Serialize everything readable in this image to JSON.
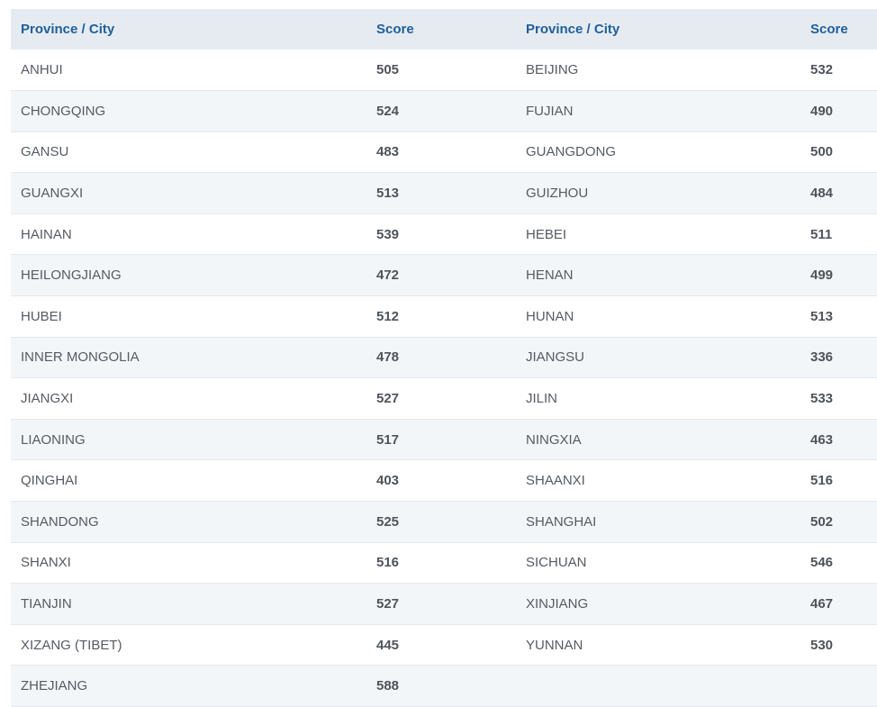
{
  "headers": {
    "province_left": "Province / City",
    "score_left": "Score",
    "province_right": "Province / City",
    "score_right": "Score"
  },
  "rows": [
    {
      "left_name": "ANHUI",
      "left_score": "505",
      "right_name": "BEIJING",
      "right_score": "532"
    },
    {
      "left_name": "CHONGQING",
      "left_score": "524",
      "right_name": "FUJIAN",
      "right_score": "490"
    },
    {
      "left_name": "GANSU",
      "left_score": "483",
      "right_name": "GUANGDONG",
      "right_score": "500"
    },
    {
      "left_name": "GUANGXI",
      "left_score": "513",
      "right_name": "GUIZHOU",
      "right_score": "484"
    },
    {
      "left_name": "HAINAN",
      "left_score": "539",
      "right_name": "HEBEI",
      "right_score": "511"
    },
    {
      "left_name": "HEILONGJIANG",
      "left_score": "472",
      "right_name": "HENAN",
      "right_score": "499"
    },
    {
      "left_name": "HUBEI",
      "left_score": "512",
      "right_name": "HUNAN",
      "right_score": "513"
    },
    {
      "left_name": "INNER MONGOLIA",
      "left_score": "478",
      "right_name": "JIANGSU",
      "right_score": "336"
    },
    {
      "left_name": "JIANGXI",
      "left_score": "527",
      "right_name": "JILIN",
      "right_score": "533"
    },
    {
      "left_name": "LIAONING",
      "left_score": "517",
      "right_name": "NINGXIA",
      "right_score": "463"
    },
    {
      "left_name": "QINGHAI",
      "left_score": "403",
      "right_name": "SHAANXI",
      "right_score": "516"
    },
    {
      "left_name": "SHANDONG",
      "left_score": "525",
      "right_name": "SHANGHAI",
      "right_score": "502"
    },
    {
      "left_name": "SHANXI",
      "left_score": "516",
      "right_name": "SICHUAN",
      "right_score": "546"
    },
    {
      "left_name": "TIANJIN",
      "left_score": "527",
      "right_name": "XINJIANG",
      "right_score": "467"
    },
    {
      "left_name": "XIZANG (TIBET)",
      "left_score": "445",
      "right_name": "YUNNAN",
      "right_score": "530"
    },
    {
      "left_name": "ZHEJIANG",
      "left_score": "588",
      "right_name": "",
      "right_score": ""
    }
  ],
  "colors": {
    "header_bg": "#e6ebf1",
    "header_text": "#1e5f99",
    "row_alt_bg": "#f3f6f9",
    "body_text": "#555b62"
  }
}
